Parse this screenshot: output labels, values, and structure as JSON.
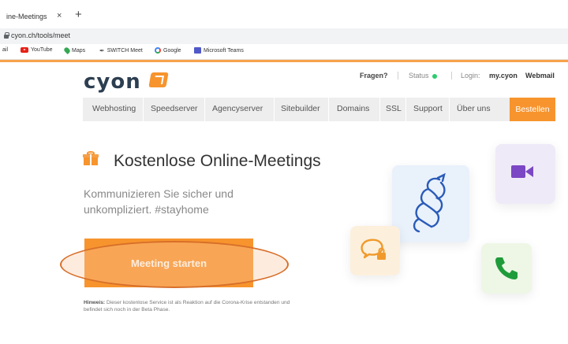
{
  "browser": {
    "tab_title": "ine-Meetings",
    "tab_close": "×",
    "new_tab": "+",
    "url": "cyon.ch/tools/meet",
    "bookmarks": [
      "ail",
      "YouTube",
      "Maps",
      "SWITCH Meet",
      "Google",
      "Microsoft Teams"
    ]
  },
  "site": {
    "logo": "cyon",
    "top_links": {
      "faq": "Fragen?",
      "status": "Status",
      "login_label": "Login:",
      "mycyon": "my.cyon",
      "webmail": "Webmail"
    },
    "nav": [
      "Webhosting",
      "Speedserver",
      "Agencyserver",
      "Sitebuilder",
      "Domains",
      "SSL",
      "Support",
      "Über uns"
    ],
    "nav_cta": "Bestellen",
    "accent_color": "#f7942d"
  },
  "hero": {
    "title": "Kostenlose Online-Meetings",
    "subtitle": "Kommunizieren Sie sicher und unkompliziert. #stayhome",
    "button": "Meeting starten",
    "hint_label": "Hinweis:",
    "hint_text": "Dieser kostenlose Service ist als Reaktion auf die Corona-Krise entstanden und befindet sich noch in der Beta Phase."
  },
  "illustration": {
    "icons": [
      "jitsi-logo-icon",
      "video-camera-icon",
      "secure-chat-icon",
      "phone-icon"
    ]
  }
}
